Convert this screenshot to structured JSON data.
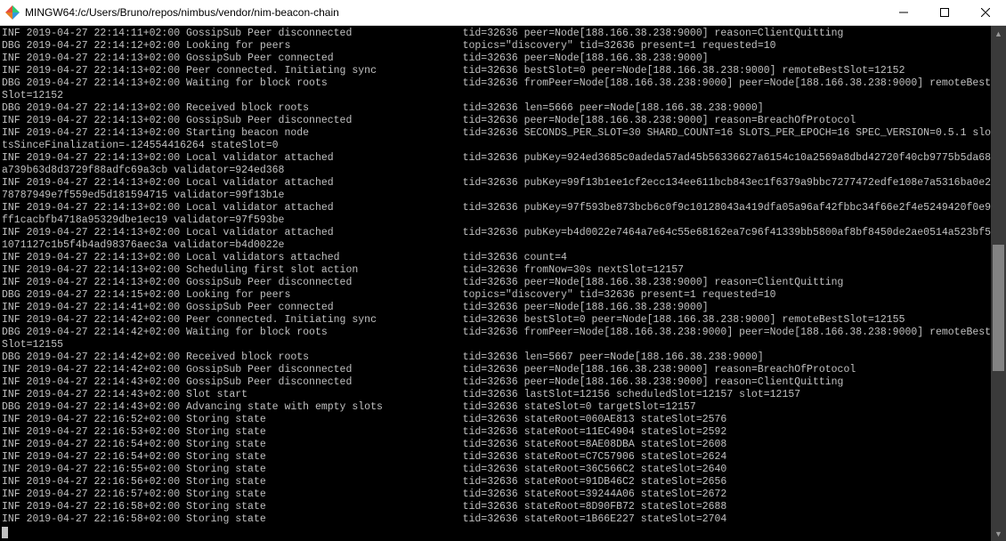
{
  "window": {
    "title": "MINGW64:/c/Users/Bruno/repos/nimbus/vendor/nim-beacon-chain",
    "controls": {
      "min": "—",
      "max": "▢",
      "close": "✕"
    }
  },
  "terminal": {
    "col_msg": 27,
    "col_extra": 75,
    "logs": [
      {
        "level": "INF",
        "ts": "2019-04-27 22:14:11+02:00",
        "msg": "GossipSub Peer disconnected",
        "extras": "tid=32636 peer=Node[188.166.38.238:9000] reason=ClientQuitting"
      },
      {
        "level": "DBG",
        "ts": "2019-04-27 22:14:12+02:00",
        "msg": "Looking for peers",
        "extras": "topics=\"discovery\" tid=32636 present=1 requested=10"
      },
      {
        "level": "INF",
        "ts": "2019-04-27 22:14:13+02:00",
        "msg": "GossipSub Peer connected",
        "extras": "tid=32636 peer=Node[188.166.38.238:9000]"
      },
      {
        "level": "INF",
        "ts": "2019-04-27 22:14:13+02:00",
        "msg": "Peer connected. Initiating sync",
        "extras": "tid=32636 bestSlot=0 peer=Node[188.166.38.238:9000] remoteBestSlot=12152"
      },
      {
        "level": "DBG",
        "ts": "2019-04-27 22:14:13+02:00",
        "msg": "Waiting for block roots",
        "extras": "tid=32636 fromPeer=Node[188.166.38.238:9000] peer=Node[188.166.38.238:9000] remoteBest",
        "wrap": "Slot=12152"
      },
      {
        "level": "DBG",
        "ts": "2019-04-27 22:14:13+02:00",
        "msg": "Received block roots",
        "extras": "tid=32636 len=5666 peer=Node[188.166.38.238:9000]"
      },
      {
        "level": "INF",
        "ts": "2019-04-27 22:14:13+02:00",
        "msg": "GossipSub Peer disconnected",
        "extras": "tid=32636 peer=Node[188.166.38.238:9000] reason=BreachOfProtocol"
      },
      {
        "level": "INF",
        "ts": "2019-04-27 22:14:13+02:00",
        "msg": "Starting beacon node",
        "extras": "tid=32636 SECONDS_PER_SLOT=30 SHARD_COUNT=16 SLOTS_PER_EPOCH=16 SPEC_VERSION=0.5.1 slo",
        "wrap": "tsSinceFinalization=-124554416264 stateSlot=0"
      },
      {
        "level": "INF",
        "ts": "2019-04-27 22:14:13+02:00",
        "msg": "Local validator attached",
        "extras": "tid=32636 pubKey=924ed3685c0adeda57ad45b56336627a6154c10a2569a8dbd42720f40cb9775b5da68",
        "wrap": "a739b63d8d3729f88adfc69a3cb validator=924ed368"
      },
      {
        "level": "INF",
        "ts": "2019-04-27 22:14:13+02:00",
        "msg": "Local validator attached",
        "extras": "tid=32636 pubKey=99f13b1ee1cf2ecc134ee611bcb843ec1f6379a9bbc7277472edfe108e7a5316ba0e2",
        "wrap": "78787949e7f559ed5d181594715 validator=99f13b1e"
      },
      {
        "level": "INF",
        "ts": "2019-04-27 22:14:13+02:00",
        "msg": "Local validator attached",
        "extras": "tid=32636 pubKey=97f593be873bcb6c0f9c10128043a419dfa05a96af42fbbc34f66e2f4e5249420f0e9",
        "wrap": "ff1cacbfb4718a95329dbe1ec19 validator=97f593be"
      },
      {
        "level": "INF",
        "ts": "2019-04-27 22:14:13+02:00",
        "msg": "Local validator attached",
        "extras": "tid=32636 pubKey=b4d0022e7464a7e64c55e68162ea7c96f41339bb5800af8bf8450de2ae0514a523bf5",
        "wrap": "1071127c1b5f4b4ad98376aec3a validator=b4d0022e"
      },
      {
        "level": "INF",
        "ts": "2019-04-27 22:14:13+02:00",
        "msg": "Local validators attached",
        "extras": "tid=32636 count=4"
      },
      {
        "level": "INF",
        "ts": "2019-04-27 22:14:13+02:00",
        "msg": "Scheduling first slot action",
        "extras": "tid=32636 fromNow=30s nextSlot=12157"
      },
      {
        "level": "INF",
        "ts": "2019-04-27 22:14:13+02:00",
        "msg": "GossipSub Peer disconnected",
        "extras": "tid=32636 peer=Node[188.166.38.238:9000] reason=ClientQuitting"
      },
      {
        "level": "DBG",
        "ts": "2019-04-27 22:14:15+02:00",
        "msg": "Looking for peers",
        "extras": "topics=\"discovery\" tid=32636 present=1 requested=10"
      },
      {
        "level": "INF",
        "ts": "2019-04-27 22:14:41+02:00",
        "msg": "GossipSub Peer connected",
        "extras": "tid=32636 peer=Node[188.166.38.238:9000]"
      },
      {
        "level": "INF",
        "ts": "2019-04-27 22:14:42+02:00",
        "msg": "Peer connected. Initiating sync",
        "extras": "tid=32636 bestSlot=0 peer=Node[188.166.38.238:9000] remoteBestSlot=12155"
      },
      {
        "level": "DBG",
        "ts": "2019-04-27 22:14:42+02:00",
        "msg": "Waiting for block roots",
        "extras": "tid=32636 fromPeer=Node[188.166.38.238:9000] peer=Node[188.166.38.238:9000] remoteBest",
        "wrap": "Slot=12155"
      },
      {
        "level": "DBG",
        "ts": "2019-04-27 22:14:42+02:00",
        "msg": "Received block roots",
        "extras": "tid=32636 len=5667 peer=Node[188.166.38.238:9000]"
      },
      {
        "level": "INF",
        "ts": "2019-04-27 22:14:42+02:00",
        "msg": "GossipSub Peer disconnected",
        "extras": "tid=32636 peer=Node[188.166.38.238:9000] reason=BreachOfProtocol"
      },
      {
        "level": "INF",
        "ts": "2019-04-27 22:14:43+02:00",
        "msg": "GossipSub Peer disconnected",
        "extras": "tid=32636 peer=Node[188.166.38.238:9000] reason=ClientQuitting"
      },
      {
        "level": "INF",
        "ts": "2019-04-27 22:14:43+02:00",
        "msg": "Slot start",
        "extras": "tid=32636 lastSlot=12156 scheduledSlot=12157 slot=12157"
      },
      {
        "level": "DBG",
        "ts": "2019-04-27 22:14:43+02:00",
        "msg": "Advancing state with empty slots",
        "extras": "tid=32636 stateSlot=0 targetSlot=12157"
      },
      {
        "level": "INF",
        "ts": "2019-04-27 22:16:52+02:00",
        "msg": "Storing state",
        "extras": "tid=32636 stateRoot=060AE813 stateSlot=2576"
      },
      {
        "level": "INF",
        "ts": "2019-04-27 22:16:53+02:00",
        "msg": "Storing state",
        "extras": "tid=32636 stateRoot=11EC4904 stateSlot=2592"
      },
      {
        "level": "INF",
        "ts": "2019-04-27 22:16:54+02:00",
        "msg": "Storing state",
        "extras": "tid=32636 stateRoot=8AE08DBA stateSlot=2608"
      },
      {
        "level": "INF",
        "ts": "2019-04-27 22:16:54+02:00",
        "msg": "Storing state",
        "extras": "tid=32636 stateRoot=C7C57906 stateSlot=2624"
      },
      {
        "level": "INF",
        "ts": "2019-04-27 22:16:55+02:00",
        "msg": "Storing state",
        "extras": "tid=32636 stateRoot=36C566C2 stateSlot=2640"
      },
      {
        "level": "INF",
        "ts": "2019-04-27 22:16:56+02:00",
        "msg": "Storing state",
        "extras": "tid=32636 stateRoot=91DB46C2 stateSlot=2656"
      },
      {
        "level": "INF",
        "ts": "2019-04-27 22:16:57+02:00",
        "msg": "Storing state",
        "extras": "tid=32636 stateRoot=39244A06 stateSlot=2672"
      },
      {
        "level": "INF",
        "ts": "2019-04-27 22:16:58+02:00",
        "msg": "Storing state",
        "extras": "tid=32636 stateRoot=8D90FB72 stateSlot=2688"
      },
      {
        "level": "INF",
        "ts": "2019-04-27 22:16:58+02:00",
        "msg": "Storing state",
        "extras": "tid=32636 stateRoot=1B66E227 stateSlot=2704"
      }
    ]
  }
}
